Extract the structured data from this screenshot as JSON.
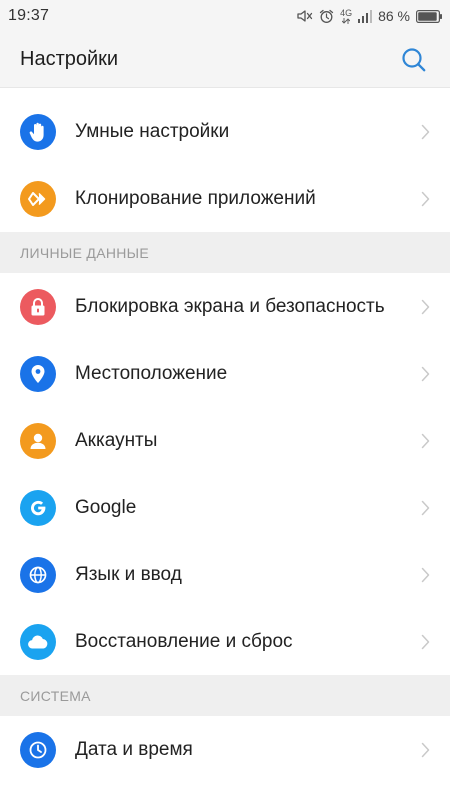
{
  "status_bar": {
    "time": "19:37",
    "network": "4G",
    "battery": "86 %"
  },
  "header": {
    "title": "Настройки",
    "search_icon": "search-icon"
  },
  "colors": {
    "accent_blue": "#1a73e8",
    "orange": "#f39a1e",
    "red": "#ec5a5f",
    "light_blue": "#1aa3f0",
    "section_bg": "#efefef",
    "section_text": "#9a9a9a"
  },
  "items_top": [
    {
      "label": "Умные настройки",
      "icon": "hand-icon"
    },
    {
      "label": "Клонирование приложений",
      "icon": "clone-icon"
    }
  ],
  "section_personal": {
    "title": "ЛИЧНЫЕ ДАННЫЕ",
    "items": [
      {
        "label": "Блокировка экрана и безопасность",
        "icon": "lock-icon"
      },
      {
        "label": "Местоположение",
        "icon": "location-pin-icon"
      },
      {
        "label": "Аккаунты",
        "icon": "person-icon"
      },
      {
        "label": "Google",
        "icon": "google-g-icon"
      },
      {
        "label": "Язык и ввод",
        "icon": "globe-icon"
      },
      {
        "label": "Восстановление и сброс",
        "icon": "cloud-icon"
      }
    ]
  },
  "section_system": {
    "title": "СИСТЕМА",
    "items": [
      {
        "label": "Дата и время",
        "icon": "clock-icon"
      }
    ]
  }
}
